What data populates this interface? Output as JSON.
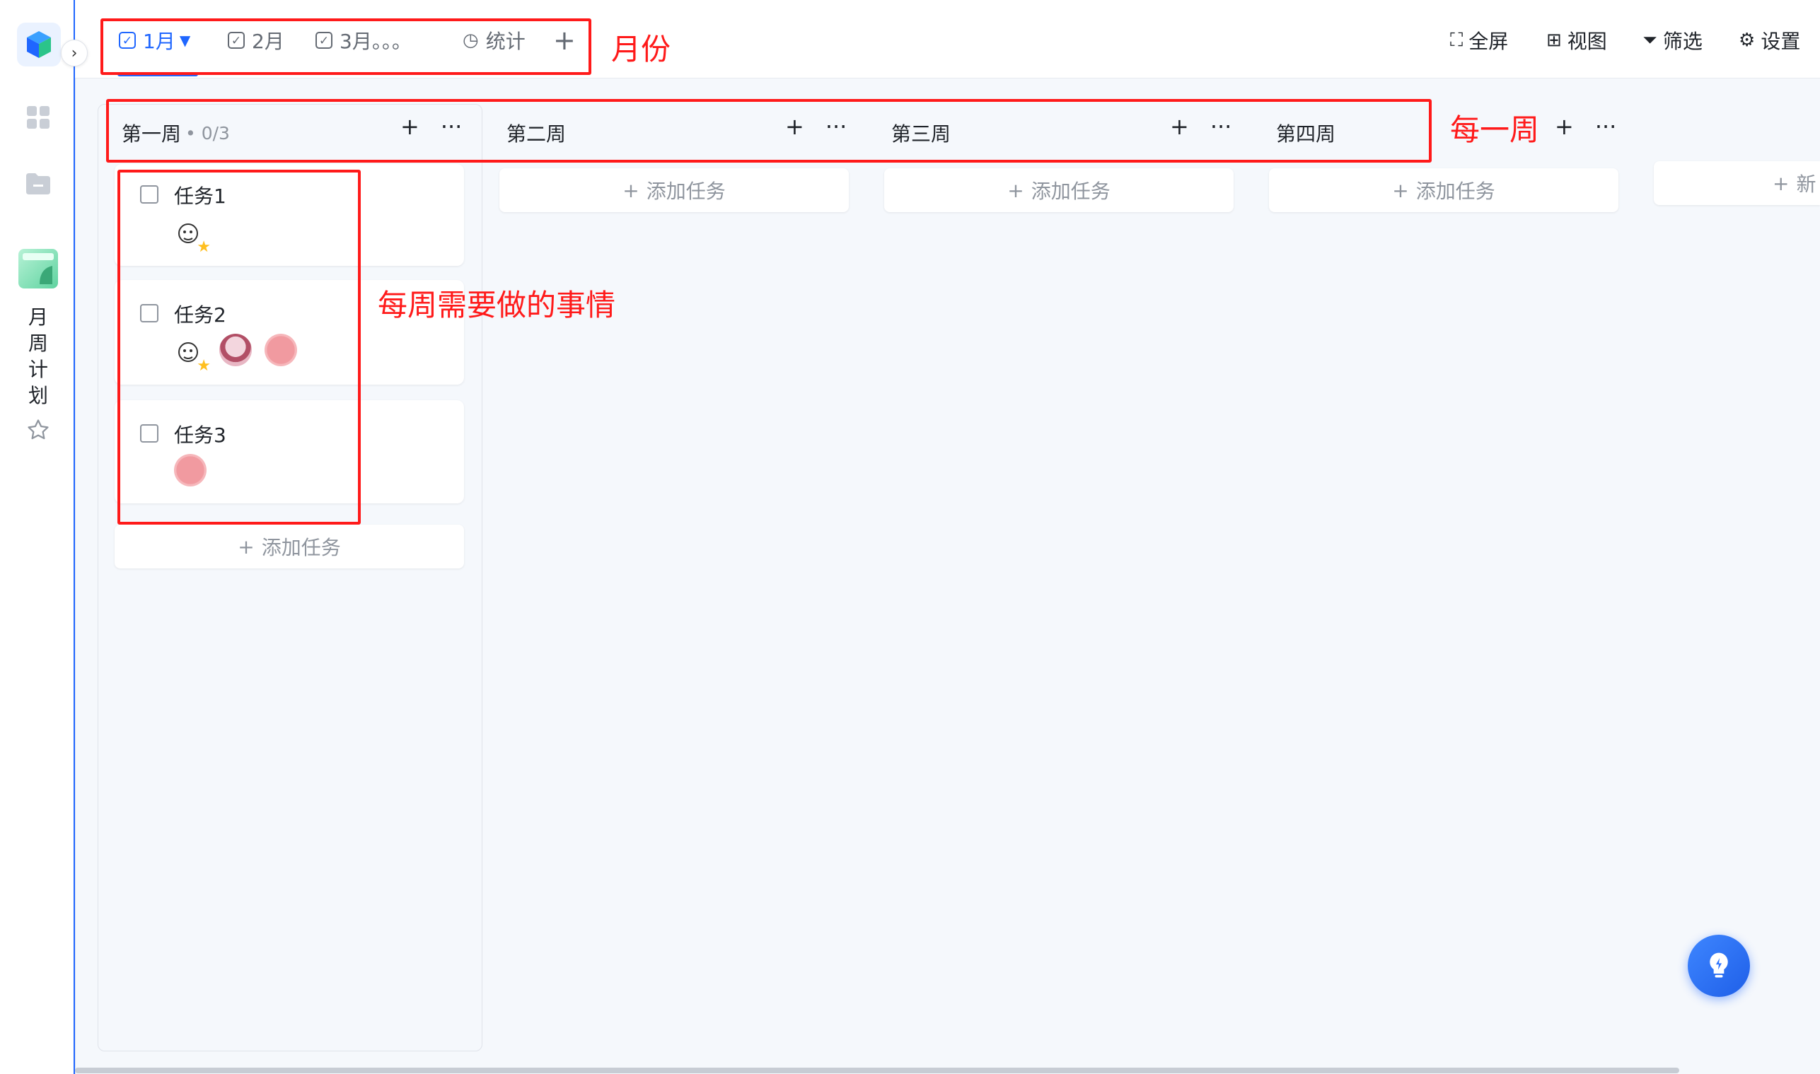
{
  "sidebar": {
    "title": "月周计划",
    "title_chars": [
      "月",
      "周",
      "计",
      "划"
    ]
  },
  "tabs": [
    {
      "label": "1月",
      "active": true,
      "icon": "check-square-icon",
      "has_dropdown": true
    },
    {
      "label": "2月",
      "active": false,
      "icon": "check-square-icon"
    },
    {
      "label": "3月。。。",
      "active": false,
      "icon": "check-square-icon"
    },
    {
      "label": "统计",
      "active": false,
      "icon": "clock-icon"
    }
  ],
  "toolbar": {
    "fullscreen": "全屏",
    "view": "视图",
    "filter": "筛选",
    "settings": "设置"
  },
  "columns": [
    {
      "title": "第一周",
      "count": "• 0/3"
    },
    {
      "title": "第二周"
    },
    {
      "title": "第三周"
    },
    {
      "title": "第四周"
    }
  ],
  "new_group_partial": "新",
  "tasks": [
    {
      "title": "任务1",
      "done": false,
      "assignees": [
        "doodle"
      ]
    },
    {
      "title": "任务2",
      "done": false,
      "assignees": [
        "doodle",
        "anime",
        "pink"
      ]
    },
    {
      "title": "任务3",
      "done": false,
      "assignees": [
        "pink"
      ]
    }
  ],
  "add_task_label": "添加任务",
  "annotations": {
    "month": "月份",
    "week": "每一周",
    "tasks": "每周需要做的事情"
  },
  "colors": {
    "accent": "#1f66ff",
    "annotation": "#ff1a1a"
  }
}
